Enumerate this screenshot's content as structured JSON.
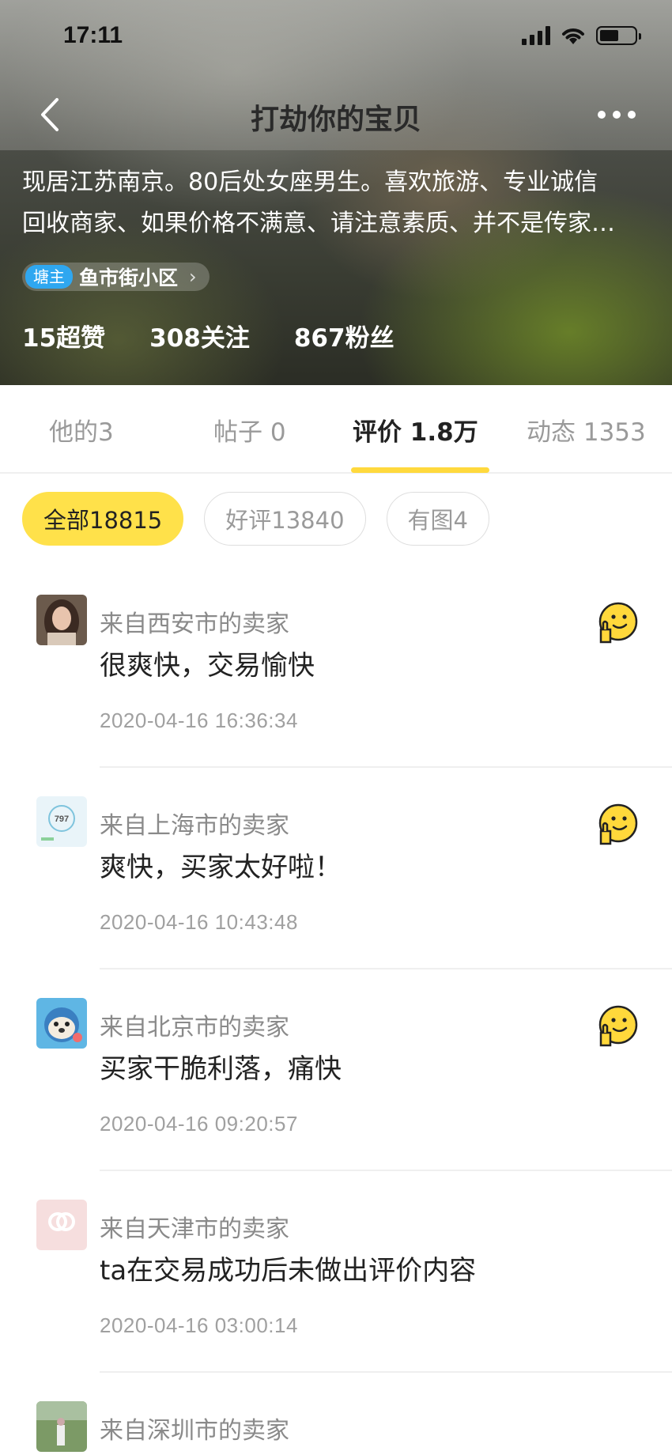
{
  "status_bar": {
    "time": "17:11"
  },
  "nav": {
    "title": "打劫你的宝贝"
  },
  "profile": {
    "bio_line1": "现居江苏南京。80后处女座男生。喜欢旅游、专业诚信",
    "bio_line2": "回收商家、如果价格不满意、请注意素质、并不是传家…",
    "pond_badge": "塘主",
    "pond_name": "鱼市街小区",
    "stats": [
      "15超赞",
      "308关注",
      "867粉丝"
    ]
  },
  "tabs": [
    {
      "label": "他的3"
    },
    {
      "label": "帖子 0"
    },
    {
      "label": "评价 1.8万"
    },
    {
      "label": "动态 1353"
    }
  ],
  "filters": [
    {
      "label": "全部18815"
    },
    {
      "label": "好评13840"
    },
    {
      "label": "有图4"
    }
  ],
  "reviews": [
    {
      "reviewer": "来自西安市的卖家",
      "text": "很爽快，交易愉快",
      "time": "2020-04-16 16:36:34",
      "avatar": "portrait-photo"
    },
    {
      "reviewer": "来自上海市的卖家",
      "text": "爽快，买家太好啦！",
      "time": "2020-04-16 10:43:48",
      "avatar": "score-badge",
      "avatar_text": "797"
    },
    {
      "reviewer": "来自北京市的卖家",
      "text": "买家干脆利落，痛快",
      "time": "2020-04-16 09:20:57",
      "avatar": "seal-cartoon"
    },
    {
      "reviewer": "来自天津市的卖家",
      "text": "ta在交易成功后未做出评价内容",
      "time": "2020-04-16 03:00:14",
      "avatar": "chanel-logo"
    },
    {
      "reviewer": "来自深圳市的卖家",
      "text": "",
      "time": "",
      "avatar": "outdoor-photo"
    }
  ],
  "colors": {
    "accent_yellow": "#ffe14a",
    "tab_underline": "#ffd93d",
    "pond_badge_blue": "#2fa7f0"
  }
}
